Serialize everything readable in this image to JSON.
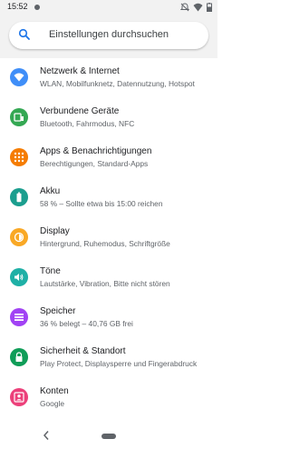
{
  "status_bar": {
    "time": "15:52",
    "icons": [
      "notification-dot-icon",
      "do-not-disturb-off-icon",
      "wifi-icon",
      "battery-icon"
    ]
  },
  "search": {
    "placeholder": "Einstellungen durchsuchen",
    "icon": "search-icon"
  },
  "items": [
    {
      "id": "network",
      "title": "Netzwerk & Internet",
      "subtitle": "WLAN, Mobilfunknetz, Datennutzung, Hotspot",
      "icon": "wifi-icon",
      "color": "#3f8ef8"
    },
    {
      "id": "devices",
      "title": "Verbundene Geräte",
      "subtitle": "Bluetooth, Fahrmodus, NFC",
      "icon": "devices-icon",
      "color": "#34a853"
    },
    {
      "id": "apps",
      "title": "Apps & Benachrichtigungen",
      "subtitle": "Berechtigungen, Standard-Apps",
      "icon": "apps-grid-icon",
      "color": "#f57c00"
    },
    {
      "id": "battery",
      "title": "Akku",
      "subtitle": "58 % – Sollte etwa bis 15:00 reichen",
      "icon": "battery-icon",
      "color": "#1b9e8e"
    },
    {
      "id": "display",
      "title": "Display",
      "subtitle": "Hintergrund, Ruhemodus, Schriftgröße",
      "icon": "brightness-icon",
      "color": "#f9a825"
    },
    {
      "id": "sound",
      "title": "Töne",
      "subtitle": "Lautstärke, Vibration, Bitte nicht stören",
      "icon": "volume-icon",
      "color": "#1eb0a6"
    },
    {
      "id": "storage",
      "title": "Speicher",
      "subtitle": "36 % belegt – 40,76 GB frei",
      "icon": "storage-icon",
      "color": "#a142f4"
    },
    {
      "id": "security",
      "title": "Sicherheit & Standort",
      "subtitle": "Play Protect, Displaysperre und Fingerabdruck",
      "icon": "lock-icon",
      "color": "#0f9d58"
    },
    {
      "id": "accounts",
      "title": "Konten",
      "subtitle": "Google",
      "icon": "account-icon",
      "color": "#ec407a"
    }
  ],
  "nav": {
    "back_icon": "back-chevron-icon",
    "home_icon": "home-pill-icon"
  }
}
